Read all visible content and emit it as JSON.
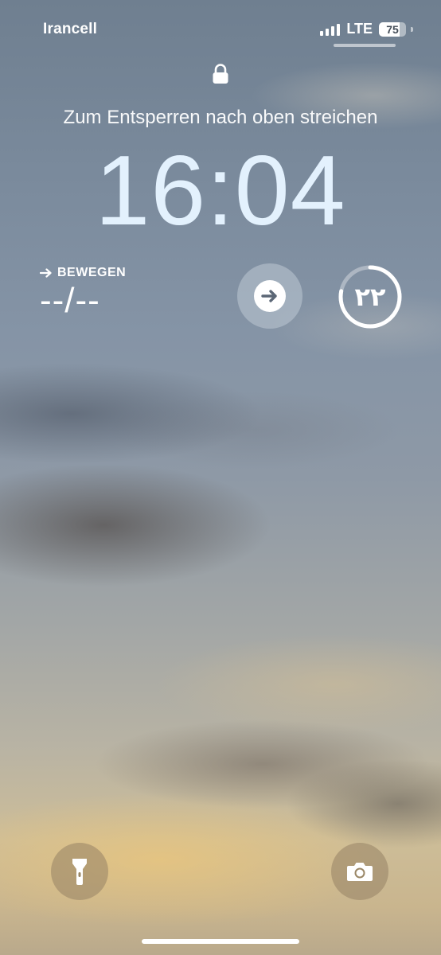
{
  "status_bar": {
    "carrier": "Irancell",
    "network": "LTE",
    "battery_level": "75",
    "battery_fraction": 0.75,
    "signal_bars": 4
  },
  "lock_screen": {
    "unlock_hint": "Zum Entsperren nach oben streichen",
    "time": "16:04"
  },
  "widgets": {
    "move": {
      "label": "BEWEGEN",
      "value": "--/--"
    },
    "activity_arrow": {
      "icon": "arrow-right-icon"
    },
    "ring": {
      "value": "۲۲",
      "progress": 0.78
    }
  },
  "quick_actions": {
    "flashlight_icon": "flashlight-icon",
    "camera_icon": "camera-icon"
  }
}
